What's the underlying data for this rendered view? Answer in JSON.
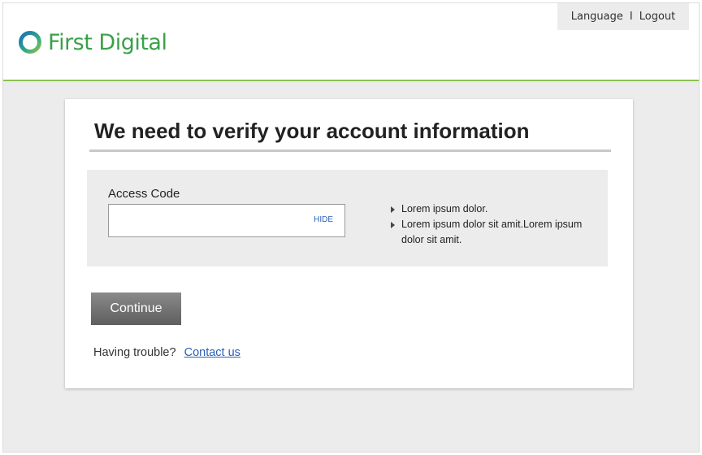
{
  "header": {
    "logo_text": "First Digital",
    "nav": {
      "language": "Language",
      "separator": "I",
      "logout": "Logout"
    }
  },
  "card": {
    "title": "We need to verify your account information",
    "access_code": {
      "label": "Access Code",
      "value": "",
      "placeholder": "",
      "toggle_label": "HIDE"
    },
    "tips": [
      "Lorem ipsum dolor.",
      "Lorem ipsum dolor sit amit.Lorem ipsum dolor sit amit."
    ],
    "continue_label": "Continue",
    "trouble_text": "Having trouble?",
    "contact_label": "Contact us"
  },
  "colors": {
    "brand_green": "#3aa14a",
    "header_rule": "#8cc152",
    "link_blue": "#2a5fb8",
    "logo_blue": "#1f6fb5"
  }
}
